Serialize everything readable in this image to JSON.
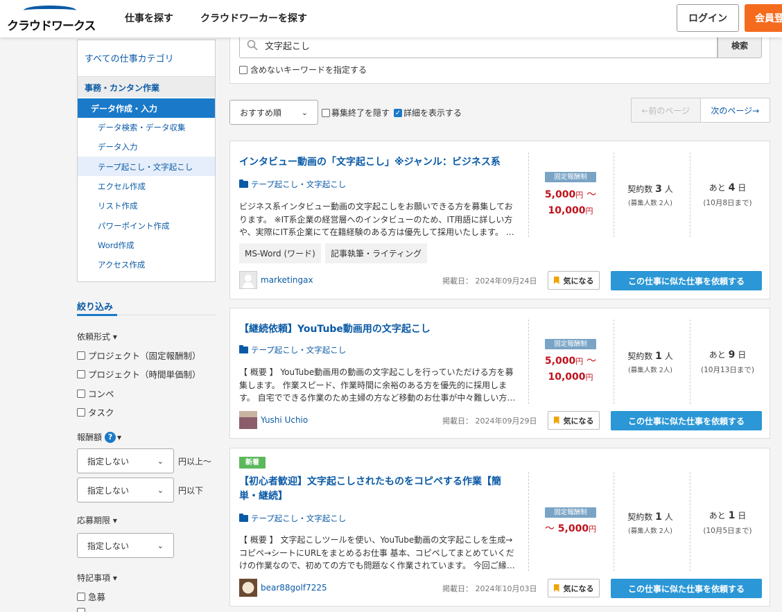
{
  "header": {
    "logo_text": "クラウドワークス",
    "nav": [
      "仕事を探す",
      "クラウドワーカーを探す"
    ],
    "login": "ログイン",
    "register": "会員登"
  },
  "search": {
    "query": "文字起こし",
    "button": "検索",
    "exclude_label": "含めないキーワードを指定する"
  },
  "sidebar": {
    "all_categories": "すべての仕事カテゴリ",
    "main_category": "事務・カンタン作業",
    "active_category": "データ作成・入力",
    "sub_categories": [
      "データ検索・データ収集",
      "データ入力",
      "テープ起こし・文字起こし",
      "エクセル作成",
      "リスト作成",
      "パワーポイント作成",
      "Word作成",
      "アクセス作成"
    ],
    "filter_title": "絞り込み",
    "type_head": "依頼形式",
    "types": [
      "プロジェクト（固定報酬制）",
      "プロジェクト（時間単価制）",
      "コンペ",
      "タスク"
    ],
    "reward_head": "報酬額",
    "reward_min": "指定しない",
    "reward_min_unit": "円以上〜",
    "reward_max": "指定しない",
    "reward_max_unit": "円以下",
    "deadline_head": "応募期限",
    "deadline": "指定しない",
    "special_head": "特記事項",
    "special_items": [
      "急募"
    ]
  },
  "toolbar": {
    "sort": "おすすめ順",
    "hide_closed": "募集終了を隠す",
    "show_detail": "詳細を表示する",
    "prev": "←前のページ",
    "next": "次のページ→"
  },
  "jobs": [
    {
      "title": "インタビュー動画の「文字起こし」※ジャンル：ビジネス系",
      "category": "テープ起こし・文字起こし",
      "description": "ビジネス系インタビュー動画の文字起こしをお願いできる方を募集しております。 ※IT系企業の経営層へのインタビューのため、IT用語に詳しい方や、実際にIT系企業にて在籍経験のある方は優先して採用いたします。 …",
      "tags": [
        "MS-Word (ワード)",
        "記事執筆・ライティング"
      ],
      "badge": "固定報酬制",
      "price_line1": "5,000",
      "price_line2": "10,000",
      "yen": "円",
      "tilde": "～",
      "contracts_label": "契約数",
      "contracts": "3",
      "person_unit": "人",
      "recruit": "(募集人数 2人)",
      "remain_prefix": "あと",
      "remain_days": "4",
      "day_unit": "日",
      "deadline": "(10月8日まで)",
      "user": "marketingax",
      "posted": "掲載日： 2024年09月24日",
      "fav": "気になる",
      "request": "この仕事に似た仕事を依頼する"
    },
    {
      "title": "【継続依頼】YouTube動画用の文字起こし",
      "category": "テープ起こし・文字起こし",
      "description": "【 概要 】 YouTube動画用の動画の文字起こしを行っていただける方を募集します。 作業スピード、作業時間に余裕のある方を優先的に採用します。 自宅でできる作業のため主婦の方など移動のお仕事が中々難しい方…",
      "badge": "固定報酬制",
      "price_line1": "5,000",
      "price_line2": "10,000",
      "yen": "円",
      "tilde": "～",
      "contracts_label": "契約数",
      "contracts": "1",
      "person_unit": "人",
      "recruit": "(募集人数 2人)",
      "remain_prefix": "あと",
      "remain_days": "9",
      "day_unit": "日",
      "deadline": "(10月13日まで)",
      "user": "Yushi Uchio",
      "posted": "掲載日： 2024年09月29日",
      "fav": "気になる",
      "request": "この仕事に似た仕事を依頼する"
    },
    {
      "new_badge": "新着",
      "title": "【初心者歓迎】文字起こしされたものをコピペする作業【簡単・継続】",
      "category": "テープ起こし・文字起こし",
      "description": "【 概要 】 文字起こしツールを使い、YouTube動画の文字起こしを生成→コピペ→シートにURLをまとめるお仕事 基本、コピペしてまとめていくだけの作業なので、初めての方でも問題なく作業されています。 今回ご縁…",
      "badge": "固定報酬制",
      "tilde": "～",
      "price_line1": "5,000",
      "yen": "円",
      "contracts_label": "契約数",
      "contracts": "1",
      "person_unit": "人",
      "recruit": "(募集人数 2人)",
      "remain_prefix": "あと",
      "remain_days": "1",
      "day_unit": "日",
      "deadline": "(10月5日まで)",
      "user": "bear88golf7225",
      "posted": "掲載日： 2024年10月03日",
      "fav": "気になる",
      "request": "この仕事に似た仕事を依頼する"
    }
  ]
}
